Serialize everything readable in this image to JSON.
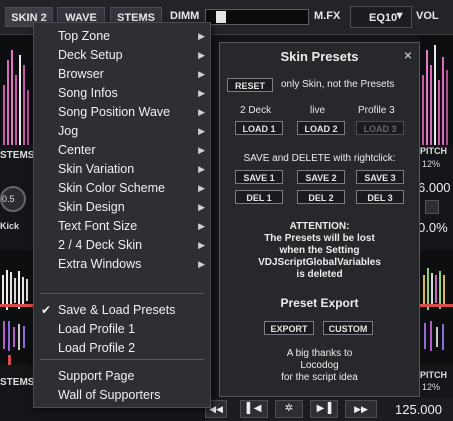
{
  "topbar": {
    "skin_btn": "SKIN 2",
    "wave_btn": "WAVE",
    "stems_btn": "STEMS",
    "dimm_label": "DIMM",
    "mfx_label": "M.FX",
    "eq_value": "EQ10",
    "eq_caret": "▼",
    "vol_label": "VOL"
  },
  "deck_bg": {
    "stems_left_1": "STEMS",
    "stems_left_2": "STEMS",
    "knob_value": "0.5",
    "kick_label": "Kick",
    "pitch_label_1": "PITCH",
    "pitch_pct_1": "12%",
    "value_1": "6.000",
    "pct_1": "0.0%",
    "pitch_label_2": "PITCH",
    "pitch_pct_2": "12%",
    "bpm_value": "125.000"
  },
  "menu": {
    "items": [
      {
        "label": "Top Zone",
        "submenu": true
      },
      {
        "label": "Deck Setup",
        "submenu": true
      },
      {
        "label": "Browser",
        "submenu": true
      },
      {
        "label": "Song Infos",
        "submenu": true
      },
      {
        "label": "Song Position Wave",
        "submenu": true
      },
      {
        "label": "Jog",
        "submenu": true
      },
      {
        "label": "Center",
        "submenu": true
      },
      {
        "label": "Skin Variation",
        "submenu": true
      },
      {
        "label": "Skin Color Scheme",
        "submenu": true
      },
      {
        "label": "Skin Design",
        "submenu": true
      },
      {
        "label": "Text Font Size",
        "submenu": true
      },
      {
        "label": "2 / 4 Deck Skin",
        "submenu": true
      },
      {
        "label": "Extra Windows",
        "submenu": true
      }
    ],
    "group2": [
      {
        "label": "Save & Load Presets",
        "checked": true
      },
      {
        "label": "Load Profile 1",
        "checked": false
      },
      {
        "label": "Load Profile 2",
        "checked": false
      }
    ],
    "group3": [
      {
        "label": "Support Page"
      },
      {
        "label": "Wall of Supporters"
      }
    ],
    "arrow_glyph": "▶",
    "check_glyph": "✔"
  },
  "panel": {
    "title": "Skin Presets",
    "close": "×",
    "reset_btn": "RESET",
    "reset_desc": "only Skin, not the Presets",
    "col1_label": "2 Deck",
    "col2_label": "live",
    "col3_label": "Profile 3",
    "load1": "LOAD 1",
    "load2": "LOAD 2",
    "load3": "LOAD 3",
    "save_delete_label": "SAVE and DELETE with rightclick:",
    "save1": "SAVE 1",
    "save2": "SAVE 2",
    "save3": "SAVE 3",
    "del1": "DEL 1",
    "del2": "DEL 2",
    "del3": "DEL 3",
    "attention_lines": [
      "ATTENTION:",
      "The Presets will be lost",
      "when the Setting",
      "VDJScriptGlobalVariables",
      "is deleted"
    ],
    "export_title": "Preset Export",
    "export_btn": "EXPORT",
    "custom_btn": "CUSTOM",
    "thanks_lines": [
      "A big thanks to",
      "Locodog",
      "for the script idea"
    ]
  }
}
